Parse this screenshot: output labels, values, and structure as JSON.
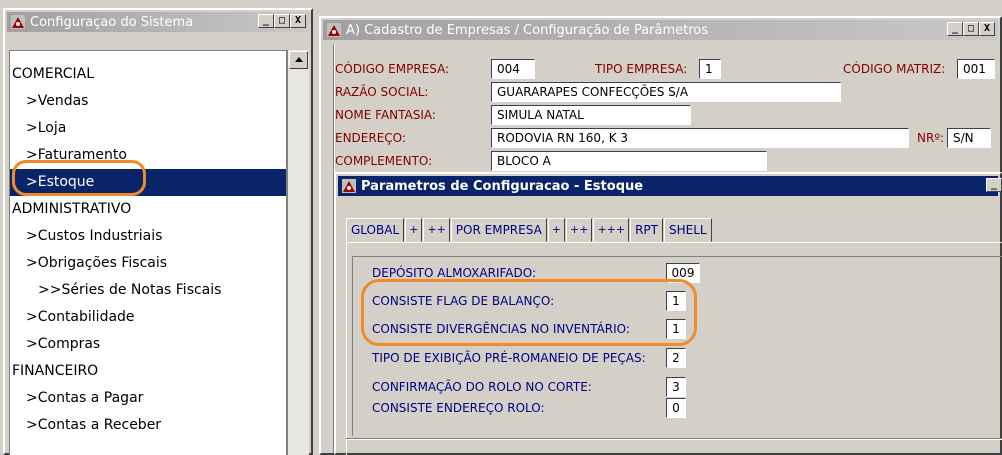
{
  "left_window": {
    "title": "Configuraçao do Sistema",
    "controls": {
      "minimize": "_",
      "restore": "□",
      "close": "X"
    },
    "tree": [
      {
        "label": "COMERCIAL",
        "level": 0
      },
      {
        "label": ">Vendas",
        "level": 1
      },
      {
        "label": ">Loja",
        "level": 1
      },
      {
        "label": ">Faturamento",
        "level": 1
      },
      {
        "label": ">Estoque",
        "level": 1,
        "selected": true
      },
      {
        "label": "ADMINISTRATIVO",
        "level": 0
      },
      {
        "label": ">Custos Industriais",
        "level": 1
      },
      {
        "label": ">Obrigações Fiscais",
        "level": 1
      },
      {
        "label": ">>Séries de Notas Fiscais",
        "level": 2
      },
      {
        "label": ">Contabilidade",
        "level": 1
      },
      {
        "label": ">Compras",
        "level": 1
      },
      {
        "label": "FINANCEIRO",
        "level": 0
      },
      {
        "label": ">Contas a Pagar",
        "level": 1
      },
      {
        "label": ">Contas a Receber",
        "level": 1
      }
    ]
  },
  "right_window": {
    "title": "A) Cadastro de Empresas / Configuração de Parâmetros",
    "controls": {
      "minimize": "_",
      "restore": "□",
      "close": "X"
    },
    "fields": {
      "codigo_empresa": {
        "label": "CÓDIGO EMPRESA:",
        "value": "004"
      },
      "tipo_empresa": {
        "label": "TIPO EMPRESA:",
        "value": "1"
      },
      "codigo_matriz": {
        "label": "CÓDIGO MATRIZ:",
        "value": "001"
      },
      "razao_social": {
        "label": "RAZÃO SOCIAL:",
        "value": "GUARARAPES CONFECÇÕES S/A"
      },
      "nome_fantasia": {
        "label": "NOME FANTASIA:",
        "value": "SIMULA NATAL"
      },
      "endereco": {
        "label": "ENDEREÇO:",
        "value": "RODOVIA RN 160, K 3"
      },
      "numero": {
        "label": "NRº:",
        "value": "S/N"
      },
      "complemento": {
        "label": "COMPLEMENTO:",
        "value": "BLOCO A"
      }
    }
  },
  "dialog": {
    "title": "Parametros de Configuracao - Estoque",
    "controls": {
      "minimize": "_"
    },
    "tabs": [
      "GLOBAL",
      "+",
      "++",
      "POR EMPRESA",
      "+",
      "++",
      "+++",
      "RPT",
      "SHELL"
    ],
    "params": [
      {
        "label": "DEPÓSITO ALMOXARIFADO:",
        "value": "009"
      },
      {
        "label": "CONSISTE FLAG DE BALANÇO:",
        "value": "1"
      },
      {
        "label": "CONSISTE DIVERGÊNCIAS NO INVENTÁRIO:",
        "value": "1"
      },
      {
        "label": "TIPO DE EXIBIÇÃO PRÉ-ROMANEIO DE PEÇAS:",
        "value": "2"
      },
      {
        "label": "CONFIRMAÇÃO DO ROLO NO CORTE:",
        "value": "3"
      },
      {
        "label": "CONSISTE ENDEREÇO ROLO:",
        "value": "0"
      }
    ]
  },
  "colors": {
    "title_active": "#0a246a",
    "selection": "#0a246a",
    "label_maroon": "#800000",
    "label_navy": "#000080",
    "highlight_orange": "#f08a2a"
  },
  "icons": [
    "app-icon",
    "minimize-icon",
    "restore-icon",
    "close-icon",
    "scroll-up-arrow-icon"
  ]
}
